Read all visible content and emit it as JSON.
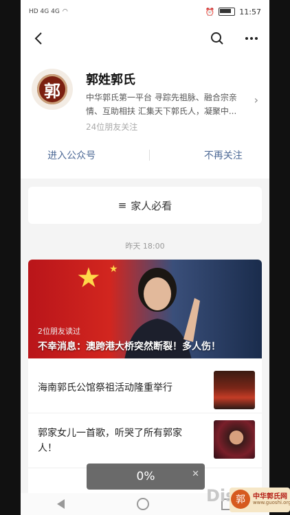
{
  "status": {
    "signals": "HD 4G 4G",
    "time": "11:57"
  },
  "profile": {
    "name": "郭姓郭氏",
    "logo_char": "郭",
    "description": "中华郭氏第一平台 寻踪先祖脉、融合宗亲情、互助相扶 汇集天下郭氏人，凝聚中...",
    "followers": "24位朋友关注",
    "enter_label": "进入公众号",
    "unfollow_label": "不再关注"
  },
  "family_card": {
    "label": "家人必看"
  },
  "feed": {
    "time": "昨天 18:00",
    "cover": {
      "read_text": "2位朋友读过",
      "title": "不幸消息：澳跨港大桥突然断裂！多人伤！"
    },
    "items": [
      {
        "title": "海南郭氏公馆祭祖活动隆重举行"
      },
      {
        "title": "郭家女儿一首歌，听哭了所有郭家人！"
      }
    ]
  },
  "toast": {
    "percent": "0%"
  },
  "watermark": {
    "dis": "Dis",
    "brand": "中华郭氏网",
    "url": "www.guoshi.org"
  },
  "colors": {
    "link": "#4e6a96",
    "background": "#f4f4f4"
  }
}
